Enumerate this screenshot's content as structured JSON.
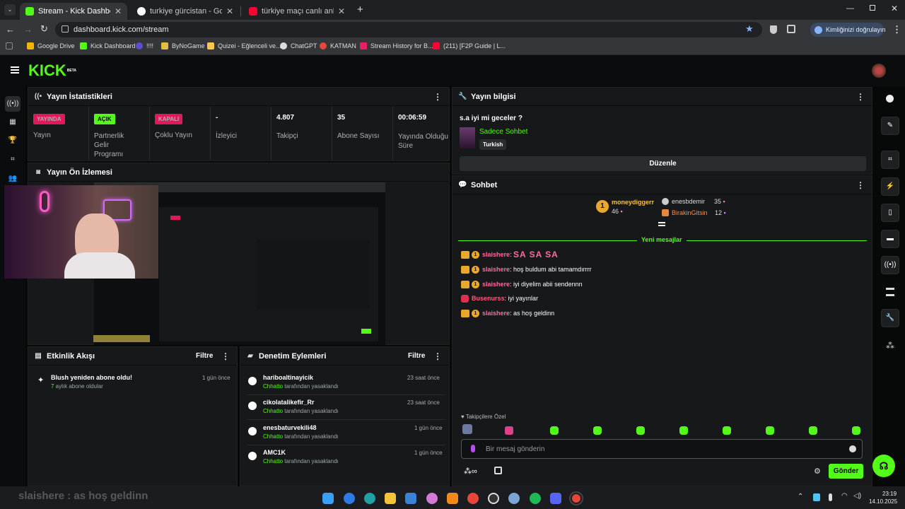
{
  "browser": {
    "tabs": [
      {
        "title": "Stream - Kick Dashboard",
        "active": true
      },
      {
        "title": "turkiye gürcistan - Google'da Ar",
        "active": false
      },
      {
        "title": "türkiye maçı canlı anlatım - You",
        "active": false
      }
    ],
    "new_tab": "+",
    "url": "dashboard.kick.com/stream",
    "verify_label": "Kimliğinizi doğrulayın",
    "bookmarks": [
      "Google Drive",
      "Kick Dashboard",
      "!!!!",
      "ByNoGame",
      "Quizei - Eğlenceli ve...",
      "ChatGPT",
      "KATMAN",
      "Stream History for B...",
      "(211) [F2P Guide | L..."
    ]
  },
  "kick": {
    "logo": "KICK",
    "logo_tag": "BETA",
    "stats_panel": {
      "title": "Yayın İstatistikleri",
      "items": [
        {
          "value": "YAYINDA",
          "label": "Yayın",
          "kind": "badge-red"
        },
        {
          "value": "AÇIK",
          "label": "Partnerlik Gelir Programı",
          "kind": "badge-green"
        },
        {
          "value": "KAPALI",
          "label": "Çoklu Yayın",
          "kind": "badge-red"
        },
        {
          "value": "-",
          "label": "İzleyici",
          "kind": "text"
        },
        {
          "value": "4.807",
          "label": "Takipçi",
          "kind": "text"
        },
        {
          "value": "35",
          "label": "Abone Sayısı",
          "kind": "text"
        },
        {
          "value": "00:06:59",
          "label": "Yayında Olduğu Süre",
          "kind": "text"
        }
      ]
    },
    "preview_panel": {
      "title": "Yayın Ön İzlemesi"
    },
    "activity_panel": {
      "title": "Etkinlik Akışı",
      "filter": "Filtre",
      "items": [
        {
          "title": "Blush yeniden abone oldu!",
          "count": "7",
          "detail": " aylık abone oldular",
          "time": "1 gün önce"
        }
      ]
    },
    "moderation_panel": {
      "title": "Denetim Eylemleri",
      "filter": "Filtre",
      "items": [
        {
          "user": "hariboaltinayicik",
          "by": "Chhatto",
          "action": " tarafından yasaklandı",
          "time": "23 saat önce"
        },
        {
          "user": "cikolatalikefir_Rr",
          "by": "Chhatto",
          "action": " tarafından yasaklandı",
          "time": "23 saat önce"
        },
        {
          "user": "enesbaturvekili48",
          "by": "Chhatto",
          "action": " tarafından yasaklandı",
          "time": "1 gün önce"
        },
        {
          "user": "AMC1K",
          "by": "Chhatto",
          "action": " tarafından yasaklandı",
          "time": "1 gün önce"
        }
      ]
    },
    "info_panel": {
      "title": "Yayın bilgisi",
      "stream_title": "s.a iyi mi geceler ?",
      "category": "Sadece Sohbet",
      "language": "Turkish",
      "edit_label": "Düzenle"
    },
    "chat_panel": {
      "title": "Sohbet",
      "top_gifters": [
        {
          "name": "moneydiggerr",
          "count": "46"
        },
        {
          "name": "enesbdemir",
          "count": "35"
        },
        {
          "name": "BirakinGitsin",
          "count": "12"
        }
      ],
      "new_messages": "Yeni mesajlar",
      "messages": [
        {
          "user": "slaishere",
          "text": "SA SA SA",
          "user_color": "#ff6b9d",
          "emote_style": true
        },
        {
          "user": "slaishere",
          "text": "hoş buldum abi tamamdırrrr",
          "user_color": "#ff6b9d",
          "emote_style": false
        },
        {
          "user": "slaishere",
          "text": "iyi diyelim abii sendennn",
          "user_color": "#ff6b9d",
          "emote_style": false
        },
        {
          "user": "Busenurss",
          "text": "iyi yayınlar",
          "user_color": "#ff5c7c",
          "emote_style": false
        },
        {
          "user": "slaishere",
          "text": "as hoş geldinn",
          "user_color": "#ff6b9d",
          "emote_style": false
        }
      ],
      "followers_only": "Takipçilere Özel",
      "input_placeholder": "Bir mesaj gönderin",
      "send_label": "Gönder"
    },
    "overlay_text": "slaishere : as hoş geldinn"
  },
  "taskbar": {
    "time": "23:19",
    "date": "14.10.2025"
  },
  "colors": {
    "accent": "#53fc18",
    "live": "#e0195a",
    "panel": "#171819"
  }
}
